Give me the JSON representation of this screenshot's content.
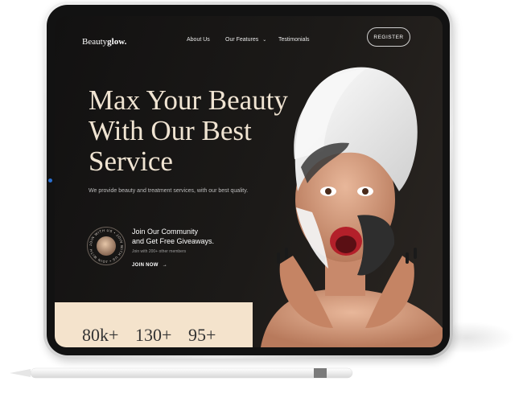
{
  "logo": {
    "prefix": "Beauty",
    "bold": "glow."
  },
  "nav": {
    "about": "About Us",
    "features": "Our Features",
    "testimonials": "Testimonials"
  },
  "register_label": "REGISTER",
  "hero": {
    "line1": "Max Your Beauty",
    "line2": "With Our Best",
    "line3": "Service"
  },
  "subtitle": "We provide  beauty and treatment services, with our best quality.",
  "community": {
    "line1": "Join Our Community",
    "line2": "and Get Free Giveaways.",
    "members": "Join with 200+ other members",
    "join_label": "JOIN NOW"
  },
  "badge_text": "JOIN WITH US • JOIN WITH US • JOIN WITH US •",
  "stats": [
    "80k+",
    "130+",
    "95+"
  ],
  "colors": {
    "accent": "#f0e4d2",
    "stats_bg": "#f4e3cc",
    "screen_bg": "#161514"
  },
  "icons": {
    "dropdown": "chevron-down-icon",
    "arrow": "arrow-right-icon"
  }
}
